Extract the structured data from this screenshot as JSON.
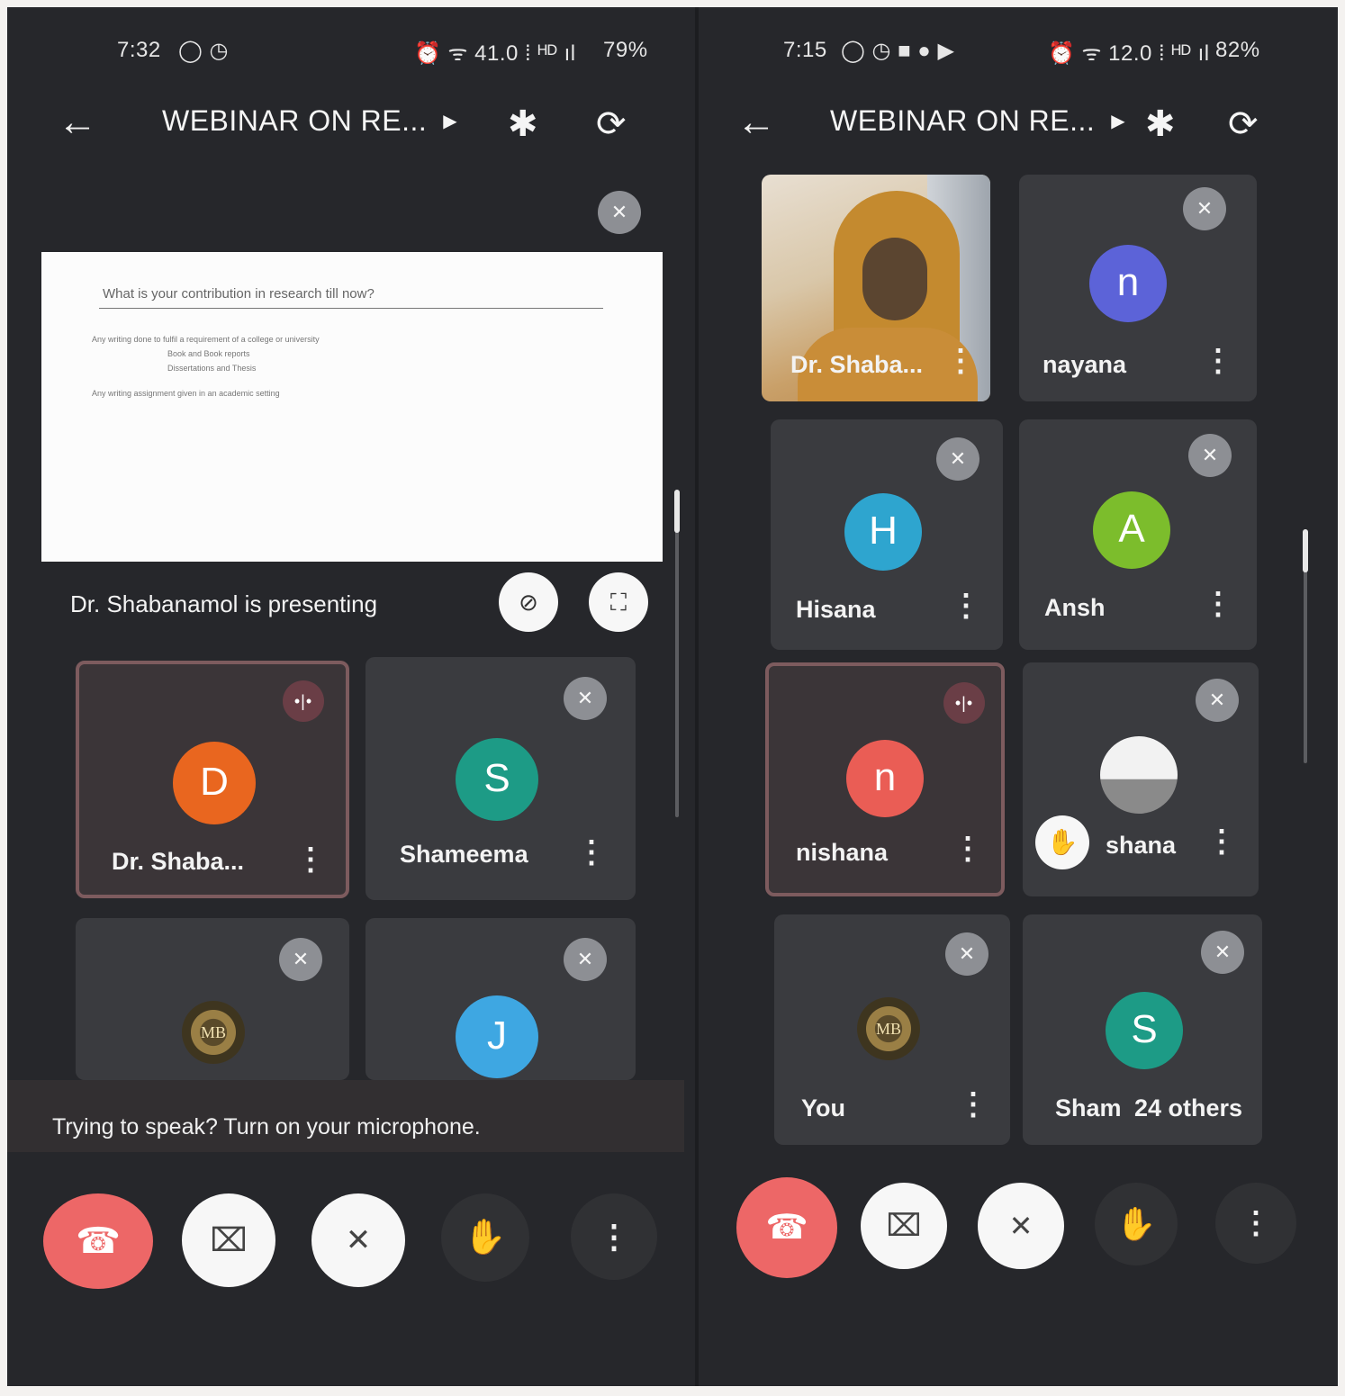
{
  "left": {
    "status": {
      "time": "7:32",
      "left_icons": "◯ ◷",
      "right_icons": "⏰ ᯤ 41.0 ⁞ ᴴᴰ ıl",
      "battery": "79%"
    },
    "toolbar": {
      "back_icon": "arrow-left-icon",
      "title": "WEBINAR ON RE...",
      "bluetooth_icon": "bluetooth-icon",
      "switch_camera_icon": "camera-switch-icon"
    },
    "slide": {
      "question": "What is your contribution in research till now?",
      "bullets": [
        "Any writing done to fulfil a requirement of a college or university",
        "Book and Book reports",
        "Dissertations and Thesis",
        "Any writing assignment given in an academic setting"
      ]
    },
    "presenting_text": "Dr. Shabanamol is presenting",
    "tiles": [
      {
        "initial": "D",
        "name": "Dr. Shaba...",
        "color": "#e9661f"
      },
      {
        "initial": "S",
        "name": "Shameema",
        "color": "#1d9b86"
      },
      {
        "initial": "",
        "name": "",
        "color": ""
      },
      {
        "initial": "J",
        "name": "",
        "color": "#3ea7e2"
      }
    ],
    "emblem_text": "MB",
    "hint": "Trying to speak? Turn on your microphone."
  },
  "right": {
    "status": {
      "time": "7:15",
      "left_icons": "◯ ◷ ■ ● ▶",
      "right_icons": "⏰ ᯤ 12.0 ⁞ ᴴᴰ ıl",
      "battery": "82%"
    },
    "toolbar": {
      "back_icon": "arrow-left-icon",
      "title": "WEBINAR ON RE...",
      "bluetooth_icon": "bluetooth-icon",
      "switch_camera_icon": "camera-switch-icon"
    },
    "tiles": [
      {
        "initial": "",
        "name": "Dr. Shaba...",
        "color": ""
      },
      {
        "initial": "n",
        "name": "nayana",
        "color": "#5c63d8"
      },
      {
        "initial": "H",
        "name": "Hisana",
        "color": "#2ea5cf"
      },
      {
        "initial": "A",
        "name": "Ansh",
        "color": "#7cbd2c"
      },
      {
        "initial": "n",
        "name": "nishana",
        "color": "#ea5d55"
      },
      {
        "initial": "",
        "name": "shana",
        "color": ""
      },
      {
        "initial": "",
        "name": "You",
        "color": ""
      },
      {
        "initial": "S",
        "name": "Sham",
        "color": "#1d9b86"
      }
    ],
    "others_label": "24 others",
    "emblem_text": "MB"
  },
  "icons": {
    "mute": "🎙̸",
    "more": "⋮",
    "end_call": "☎",
    "camera_off": "⌧",
    "mic_off": "🎤",
    "raise_hand": "✋",
    "speaking": "•|•",
    "unpin": "⊘",
    "fullscreen": "⛶"
  }
}
